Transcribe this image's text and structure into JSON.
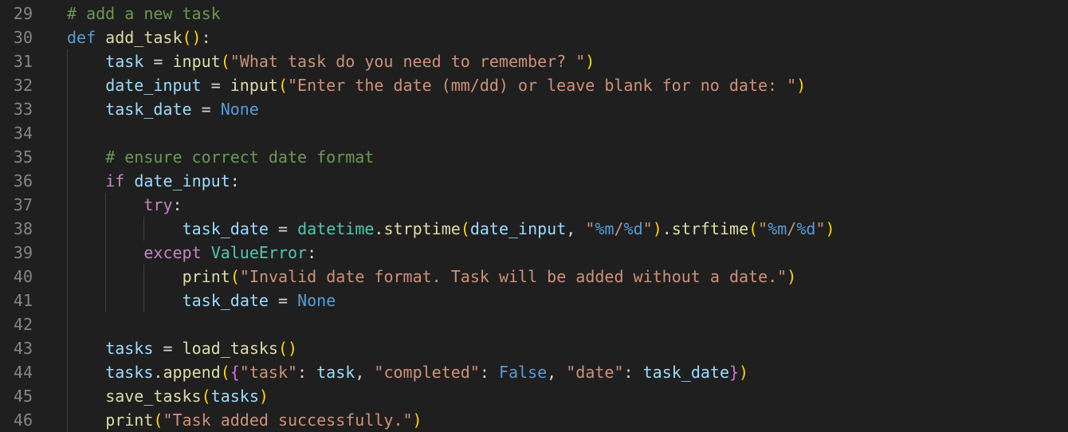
{
  "editor": {
    "language": "python",
    "colors": {
      "background": "#1f1f1f",
      "line_number": "#858585",
      "comment": "#6a9955",
      "keyword": "#569cd6",
      "control": "#c586c0",
      "function": "#dcdcaa",
      "variable": "#9cdcfe",
      "string": "#ce9178",
      "class": "#4ec9b0",
      "bracket_1": "#ffd700",
      "bracket_2": "#da70d6"
    },
    "lines": [
      {
        "number": "29",
        "indent": 0,
        "tokens": [
          [
            "t-comment",
            "# add a new task"
          ]
        ]
      },
      {
        "number": "30",
        "indent": 0,
        "tokens": [
          [
            "t-kw",
            "def"
          ],
          [
            "t-op",
            " "
          ],
          [
            "t-fn",
            "add_task"
          ],
          [
            "t-br1",
            "()"
          ],
          [
            "t-op",
            ":"
          ]
        ]
      },
      {
        "number": "31",
        "indent": 1,
        "tokens": [
          [
            "t-var",
            "task"
          ],
          [
            "t-op",
            " = "
          ],
          [
            "t-fn",
            "input"
          ],
          [
            "t-br1",
            "("
          ],
          [
            "t-str",
            "\"What task do you need to remember? \""
          ],
          [
            "t-br1",
            ")"
          ]
        ]
      },
      {
        "number": "32",
        "indent": 1,
        "tokens": [
          [
            "t-var",
            "date_input"
          ],
          [
            "t-op",
            " = "
          ],
          [
            "t-fn",
            "input"
          ],
          [
            "t-br1",
            "("
          ],
          [
            "t-str",
            "\"Enter the date (mm/dd) or leave blank for no date: \""
          ],
          [
            "t-br1",
            ")"
          ]
        ]
      },
      {
        "number": "33",
        "indent": 1,
        "tokens": [
          [
            "t-var",
            "task_date"
          ],
          [
            "t-op",
            " = "
          ],
          [
            "t-const",
            "None"
          ]
        ]
      },
      {
        "number": "34",
        "indent": 0,
        "tokens": []
      },
      {
        "number": "35",
        "indent": 1,
        "tokens": [
          [
            "t-comment",
            "# ensure correct date format"
          ]
        ]
      },
      {
        "number": "36",
        "indent": 1,
        "tokens": [
          [
            "t-ctrl",
            "if"
          ],
          [
            "t-op",
            " "
          ],
          [
            "t-var",
            "date_input"
          ],
          [
            "t-op",
            ":"
          ]
        ]
      },
      {
        "number": "37",
        "indent": 2,
        "tokens": [
          [
            "t-ctrl",
            "try"
          ],
          [
            "t-op",
            ":"
          ]
        ]
      },
      {
        "number": "38",
        "indent": 3,
        "tokens": [
          [
            "t-var",
            "task_date"
          ],
          [
            "t-op",
            " = "
          ],
          [
            "t-cls",
            "datetime"
          ],
          [
            "t-op",
            "."
          ],
          [
            "t-fn",
            "strptime"
          ],
          [
            "t-br1",
            "("
          ],
          [
            "t-var",
            "date_input"
          ],
          [
            "t-op",
            ", "
          ],
          [
            "t-str",
            "\""
          ],
          [
            "t-fmt",
            "%m"
          ],
          [
            "t-str",
            "/"
          ],
          [
            "t-fmt",
            "%d"
          ],
          [
            "t-str",
            "\""
          ],
          [
            "t-br1",
            ")"
          ],
          [
            "t-op",
            "."
          ],
          [
            "t-fn",
            "strftime"
          ],
          [
            "t-br1",
            "("
          ],
          [
            "t-str",
            "\""
          ],
          [
            "t-fmt",
            "%m"
          ],
          [
            "t-str",
            "/"
          ],
          [
            "t-fmt",
            "%d"
          ],
          [
            "t-str",
            "\""
          ],
          [
            "t-br1",
            ")"
          ]
        ]
      },
      {
        "number": "39",
        "indent": 2,
        "tokens": [
          [
            "t-ctrl",
            "except"
          ],
          [
            "t-op",
            " "
          ],
          [
            "t-cls",
            "ValueError"
          ],
          [
            "t-op",
            ":"
          ]
        ]
      },
      {
        "number": "40",
        "indent": 3,
        "tokens": [
          [
            "t-fn",
            "print"
          ],
          [
            "t-br1",
            "("
          ],
          [
            "t-str",
            "\"Invalid date format. Task will be added without a date.\""
          ],
          [
            "t-br1",
            ")"
          ]
        ]
      },
      {
        "number": "41",
        "indent": 3,
        "tokens": [
          [
            "t-var",
            "task_date"
          ],
          [
            "t-op",
            " = "
          ],
          [
            "t-const",
            "None"
          ]
        ]
      },
      {
        "number": "42",
        "indent": 0,
        "tokens": []
      },
      {
        "number": "43",
        "indent": 1,
        "tokens": [
          [
            "t-var",
            "tasks"
          ],
          [
            "t-op",
            " = "
          ],
          [
            "t-fn",
            "load_tasks"
          ],
          [
            "t-br1",
            "()"
          ]
        ]
      },
      {
        "number": "44",
        "indent": 1,
        "tokens": [
          [
            "t-var",
            "tasks"
          ],
          [
            "t-op",
            "."
          ],
          [
            "t-fn",
            "append"
          ],
          [
            "t-br1",
            "("
          ],
          [
            "t-br2",
            "{"
          ],
          [
            "t-str",
            "\"task\""
          ],
          [
            "t-op",
            ": "
          ],
          [
            "t-var",
            "task"
          ],
          [
            "t-op",
            ", "
          ],
          [
            "t-str",
            "\"completed\""
          ],
          [
            "t-op",
            ": "
          ],
          [
            "t-const",
            "False"
          ],
          [
            "t-op",
            ", "
          ],
          [
            "t-str",
            "\"date\""
          ],
          [
            "t-op",
            ": "
          ],
          [
            "t-var",
            "task_date"
          ],
          [
            "t-br2",
            "}"
          ],
          [
            "t-br1",
            ")"
          ]
        ]
      },
      {
        "number": "45",
        "indent": 1,
        "tokens": [
          [
            "t-fn",
            "save_tasks"
          ],
          [
            "t-br1",
            "("
          ],
          [
            "t-var",
            "tasks"
          ],
          [
            "t-br1",
            ")"
          ]
        ]
      },
      {
        "number": "46",
        "indent": 1,
        "tokens": [
          [
            "t-fn",
            "print"
          ],
          [
            "t-br1",
            "("
          ],
          [
            "t-str",
            "\"Task added successfully.\""
          ],
          [
            "t-br1",
            ")"
          ]
        ]
      }
    ]
  }
}
